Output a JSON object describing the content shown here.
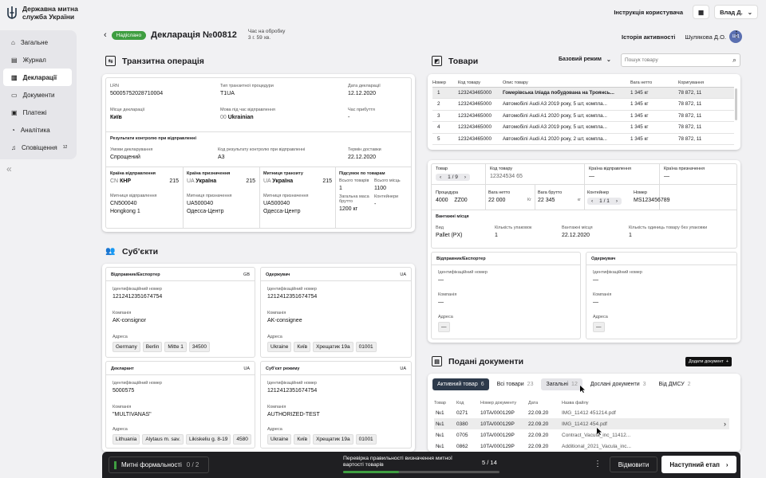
{
  "app": {
    "org_name": "Державна митна служба України"
  },
  "sidebar": {
    "items": [
      {
        "label": "Загальне",
        "icon": "home-icon"
      },
      {
        "label": "Журнал",
        "icon": "journal-icon"
      },
      {
        "label": "Декларації",
        "icon": "declaration-icon"
      },
      {
        "label": "Документи",
        "icon": "documents-icon"
      },
      {
        "label": "Платежі",
        "icon": "payments-icon"
      },
      {
        "label": "Аналітика",
        "icon": "analytics-icon"
      },
      {
        "label": "Сповіщення",
        "icon": "bell-icon",
        "count": "12"
      }
    ]
  },
  "topbar": {
    "manual": "Інструкція користувача",
    "user": "Влад Д."
  },
  "header": {
    "status": "Надіслано",
    "title": "Декларація №00812",
    "time_label": "Час на обробку",
    "time_value": "3 г. 59 хв.",
    "activity": "Історія активності",
    "inspector": "Шулякова Д.О.",
    "avatar": "ШД"
  },
  "transit": {
    "title": "Транзитна операція",
    "lrn_label": "LRN",
    "lrn": "50005752028710004",
    "proc_label": "Тип транзитної процедури",
    "proc": "T1UA",
    "date_label": "Дата декларації",
    "date": "12.12.2020",
    "place_label": "Місце декларації",
    "place": "Київ",
    "lang_label": "Мова під час відправлення",
    "lang_code": "00",
    "lang": "Ukrainian",
    "arrival_label": "Час прибуття",
    "arrival": "-",
    "control_title": "Результати контролю при відправленні",
    "cond_label": "Умови декларування",
    "cond": "Спрощений",
    "code_label": "Код результату контролю при відправленні",
    "code": "A3",
    "deadline_label": "Термін доставки",
    "deadline": "22.12.2020",
    "dep_label": "Країна відправлення",
    "dep_code": "CN",
    "dep": "КНР",
    "dep_n": "215",
    "dest_label": "Країна призначення",
    "dest_code": "UA",
    "dest": "Україна",
    "dest_n": "215",
    "tr_label": "Митниця транзиту",
    "tr_code": "UA",
    "tr": "Україна",
    "tr_n": "215",
    "sum_label": "Підсумок по товарам",
    "goods_label": "Всього товарів",
    "goods": "1",
    "places_label": "Всього місць",
    "places": "1100",
    "mass_label": "Загальна маса брутто",
    "mass": "1200 кг",
    "cont_label": "Контейнери",
    "cont": "-",
    "dep_office_label": "Митниця відправлення",
    "dep_office_code": "CN500040",
    "dep_office": "Hongkong 1",
    "dest_office_label": "Митниця призначення",
    "dest_office_code": "UA500040",
    "dest_office": "Одесса-Центр",
    "tr_office_label": "Митниця призначення",
    "tr_office_code": "UA500040",
    "tr_office": "Одесса-Центр"
  },
  "subjects": {
    "title": "Суб'єкти",
    "id_label": "Ідентифікаційний номер",
    "company_label": "Компанія",
    "address_label": "Адреса",
    "consignor": {
      "title": "Відправник/Експортер",
      "country": "GB",
      "id": "1212412351674754",
      "company": "AK-consignor",
      "address": [
        "Germany",
        "Berlin",
        "Mitte 1",
        "34500"
      ]
    },
    "consignee": {
      "title": "Одержувач",
      "country": "UA",
      "id": "1212412351674754",
      "company": "AK-consignee",
      "address": [
        "Ukraine",
        "Київ",
        "Хрещатик 19а",
        "01001"
      ]
    },
    "declarant": {
      "title": "Декларант",
      "country": "UA",
      "id": "5000575",
      "company": "\"MULTIVANAS\"",
      "address": [
        "Lithuania",
        "Alytaus m. sav.",
        "Likiskeliu g. 8-19",
        "4580"
      ]
    },
    "regime": {
      "title": "Суб'єкт режиму",
      "country": "UA",
      "id": "1212412351674754",
      "company": "AUTHORIZED-TEST",
      "address": [
        "Ukraine",
        "Київ",
        "Хрещатик 19а",
        "01001"
      ]
    }
  },
  "goods": {
    "title": "Товари",
    "mode": "Базовий режим",
    "search_placeholder": "Пошук товару",
    "columns": [
      "Номер",
      "Код товару",
      "Опис товару",
      "Вага нетто",
      "Коригування"
    ],
    "rows": [
      [
        "1",
        "123243465000",
        "Гомерівська Іліада побудована на Троянсь...",
        "1 345 кг",
        "78 872, 11"
      ],
      [
        "2",
        "123243465000",
        "Автомобілі Audi A3 2019 року, 5 шт, компла...",
        "1 345 кг",
        "78 872, 11"
      ],
      [
        "3",
        "123243465000",
        "Автомобілі Audi A1 2020 року, 5 шт, компла...",
        "1 345 кг",
        "78 872, 11"
      ],
      [
        "4",
        "123243465000",
        "Автомобілі Audi A3 2019 року, 5 шт, компла...",
        "1 345 кг",
        "78 872, 11"
      ],
      [
        "5",
        "123243465000",
        "Автомобілі Audi A1 2020 року, 2 шт, компла...",
        "1 345 кг",
        "78 872, 11"
      ]
    ]
  },
  "item": {
    "item_label": "Товар",
    "item_pos": "1 / 9",
    "code_label": "Код товару",
    "code": "12324534 65",
    "dep_label": "Країна відправлення",
    "dep": "—",
    "dest_label": "Країна призначення",
    "dest": "—",
    "proc_label": "Процедура",
    "proc1": "4000",
    "proc2": "ZZ00",
    "net_label": "Вага нетто",
    "net": "22 000",
    "net_unit": "Кг",
    "gross_label": "Вага брутто",
    "gross": "22 345",
    "gross_unit": "кг",
    "container_label": "Контейнер",
    "container_pos": "1 / 1",
    "number_label": "Номер",
    "number": "MS123456789",
    "places_title": "Вантажні місця",
    "kind_label": "Вид",
    "kind": "Pallet (PX)",
    "qty_label": "Кількість упаковок",
    "qty": "1",
    "mark_label": "Вантажні місця",
    "mark": "22.12.2020",
    "unpacked_label": "Кількість одиниць товару без упаковки",
    "unpacked": "1",
    "sender_title": "Відправник/Експортер",
    "receiver_title": "Одержувач",
    "id_label": "Ідентифікаційний номер",
    "company_label": "Компанія",
    "address_label": "Адреса",
    "dash": "—"
  },
  "docs": {
    "title": "Подані документи",
    "add": "Додати документ",
    "tabs": [
      {
        "label": "Активний товар",
        "count": "6"
      },
      {
        "label": "Всі товари",
        "count": "23"
      },
      {
        "label": "Загальні",
        "count": "12"
      },
      {
        "label": "Дослані документи",
        "count": "3"
      },
      {
        "label": "Від ДМСУ",
        "count": "2"
      }
    ],
    "columns": [
      "Товар",
      "Код",
      "Номер документу",
      "Дата",
      "Назва файлу"
    ],
    "rows": [
      [
        "№1",
        "0271",
        "10TA/000129P",
        "22.09.20",
        "IMG_11412 451214.pdf"
      ],
      [
        "№1",
        "0380",
        "10TA/000129P",
        "22.09.20",
        "IMG_11412 454.pdf"
      ],
      [
        "№1",
        "0705",
        "10TA/000129P",
        "22.09.20",
        "Contract_Vacula_inc_11412..."
      ],
      [
        "№1",
        "0862",
        "10TA/000129P",
        "22.09.20",
        "Additional_2021_Vacula_inc..."
      ]
    ]
  },
  "bottom": {
    "formalities": "Митні формальності",
    "formalities_count": "0 / 2",
    "check": "Перевірка правильності визначення митної вартості товарів",
    "progress_text": "5 / 14",
    "progress": 0.357,
    "decline": "Відмовити",
    "next": "Наступний етап"
  },
  "colors": {
    "status_green": "#3f9e41",
    "dark": "#1f1f22",
    "progress": "#3f9e41"
  }
}
